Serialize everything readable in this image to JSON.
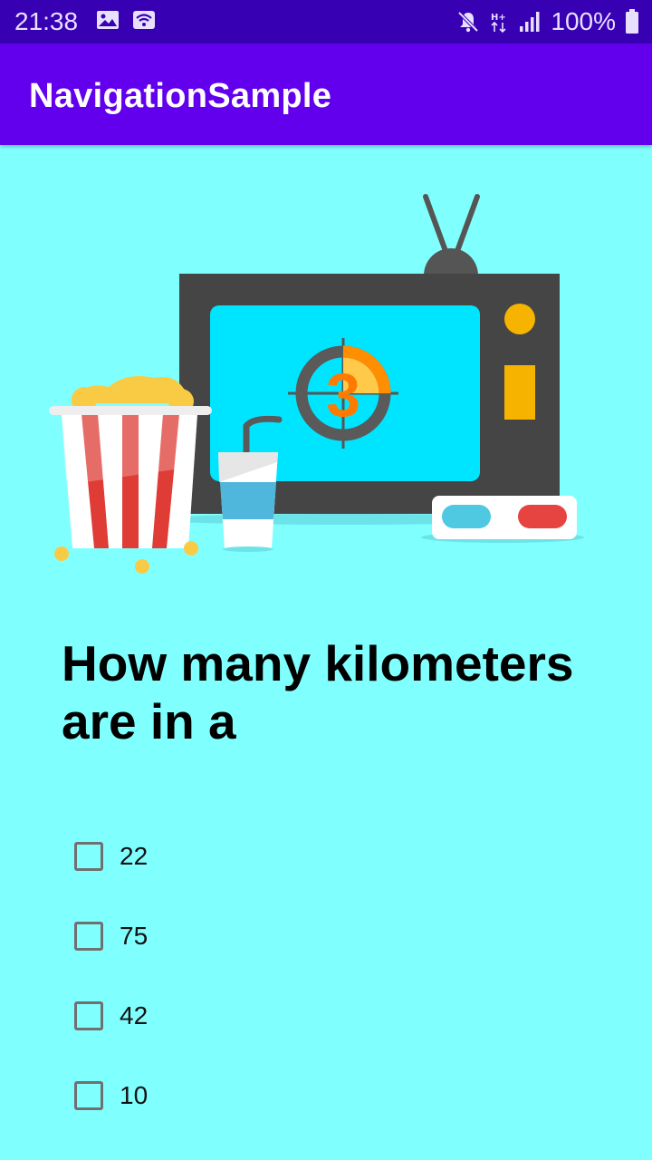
{
  "status_bar": {
    "time": "21:38",
    "battery": "100%",
    "left_icons": [
      "image-icon",
      "wifi-icon"
    ],
    "right_icons": [
      "mute-icon",
      "network-type-icon",
      "signal-icon",
      "battery-icon"
    ]
  },
  "app_bar": {
    "title": "NavigationSample"
  },
  "illustration": {
    "countdown_number": "3",
    "colors": {
      "tv_body": "#454545",
      "tv_screen": "#00E5FF",
      "countdown_accent": "#FF8F00",
      "popcorn": "#F9CB45",
      "stripes": "#DE3C35",
      "glasses_left": "#4FC8E1",
      "glasses_right": "#E54440"
    }
  },
  "question": {
    "text": "How many kilometers are in a"
  },
  "options": [
    {
      "label": "22",
      "checked": false
    },
    {
      "label": "75",
      "checked": false
    },
    {
      "label": "42",
      "checked": false
    },
    {
      "label": "10",
      "checked": false
    }
  ],
  "theme": {
    "primary": "#6200EE",
    "primary_dark": "#3700B3",
    "background": "#80FFFF"
  }
}
